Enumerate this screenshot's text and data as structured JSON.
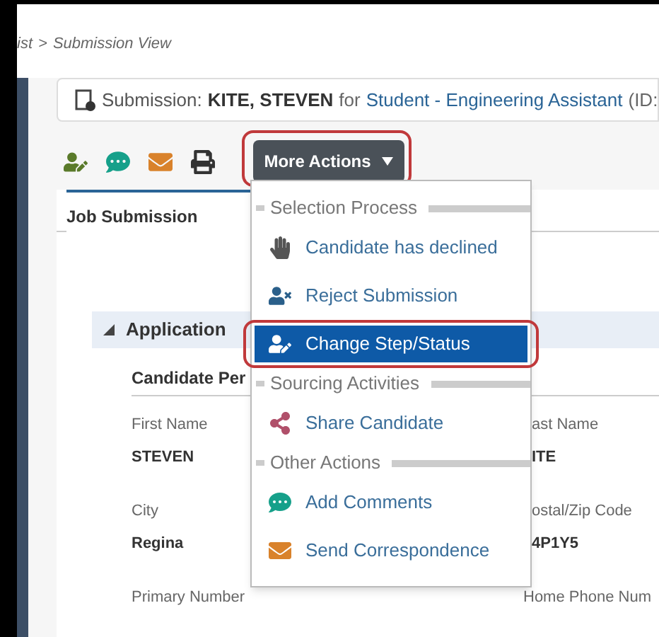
{
  "breadcrumb": {
    "parent": "ist",
    "separator": ">",
    "current": "Submission View"
  },
  "header": {
    "prefix": "Submission:",
    "candidate": "KITE, STEVEN",
    "connector": "for",
    "job": "Student - Engineering Assistant",
    "suffix": "(ID:"
  },
  "more_actions": {
    "label": "More Actions",
    "highlighted": true
  },
  "tabs": [
    {
      "label": "Job Submission",
      "selected": true
    }
  ],
  "section": {
    "label": "Application",
    "expanded": true
  },
  "subsection": "Candidate Per",
  "fields": [
    {
      "label": "First Name",
      "value": "STEVEN"
    },
    {
      "label": "ast Name",
      "value": "ITE"
    },
    {
      "label": "City",
      "value": "Regina"
    },
    {
      "label": "ostal/Zip Code",
      "value": "4P1Y5"
    },
    {
      "label": "Primary Number"
    },
    {
      "label": "Home Phone Num"
    }
  ],
  "menu": {
    "items": [
      {
        "kind": "header",
        "label": "Selection Process"
      },
      {
        "kind": "action",
        "label": "Candidate has declined",
        "selected": false,
        "highlighted": false
      },
      {
        "kind": "action",
        "label": "Reject Submission",
        "selected": false,
        "highlighted": false
      },
      {
        "kind": "action",
        "label": "Change Step/Status",
        "selected": true,
        "highlighted": true
      },
      {
        "kind": "header",
        "label": "Sourcing Activities"
      },
      {
        "kind": "action",
        "label": "Share Candidate",
        "selected": false,
        "highlighted": false
      },
      {
        "kind": "header",
        "label": "Other Actions"
      },
      {
        "kind": "action",
        "label": "Add Comments",
        "selected": false,
        "highlighted": false
      },
      {
        "kind": "action",
        "label": "Send Correspondence",
        "selected": false,
        "highlighted": false
      }
    ]
  }
}
